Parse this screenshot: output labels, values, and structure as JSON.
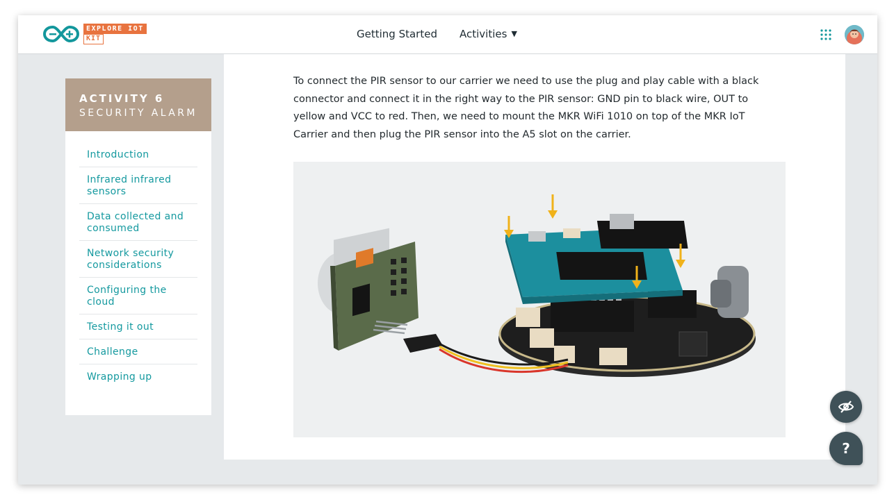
{
  "header": {
    "brand_line1": "EXPLORE IOT",
    "brand_line2": "KIT",
    "logo_icon": "arduino-infinity-icon",
    "nav": [
      {
        "label": "Getting Started"
      },
      {
        "label": "Activities",
        "caret": "▼"
      }
    ],
    "apps_icon": "apps-grid-icon",
    "avatar_icon": "user-avatar"
  },
  "sidebar": {
    "activity_number": "ACTIVITY 6",
    "activity_title": "SECURITY ALARM",
    "items": [
      {
        "label": "Introduction"
      },
      {
        "label": "Infrared infrared sensors"
      },
      {
        "label": "Data collected and consumed"
      },
      {
        "label": "Network security considerations"
      },
      {
        "label": "Configuring the cloud"
      },
      {
        "label": "Testing it out"
      },
      {
        "label": "Challenge"
      },
      {
        "label": "Wrapping up"
      }
    ]
  },
  "content": {
    "paragraph": "To connect the PIR sensor to our carrier we need to use the plug and play cable with a black connector and connect it in the right way to the PIR sensor: GND pin to black wire, OUT to yellow and VCC to red. Then, we need to mount the MKR WiFi 1010 on top of the MKR IoT Carrier and then plug the PIR sensor into the A5 slot on the carrier."
  },
  "fab": {
    "hide_icon": "eye-slash-icon",
    "help_label": "?"
  },
  "colors": {
    "accent": "#14999f",
    "brand_orange": "#e8733f",
    "activity_header": "#b49f8c",
    "fab": "#3f5158"
  }
}
